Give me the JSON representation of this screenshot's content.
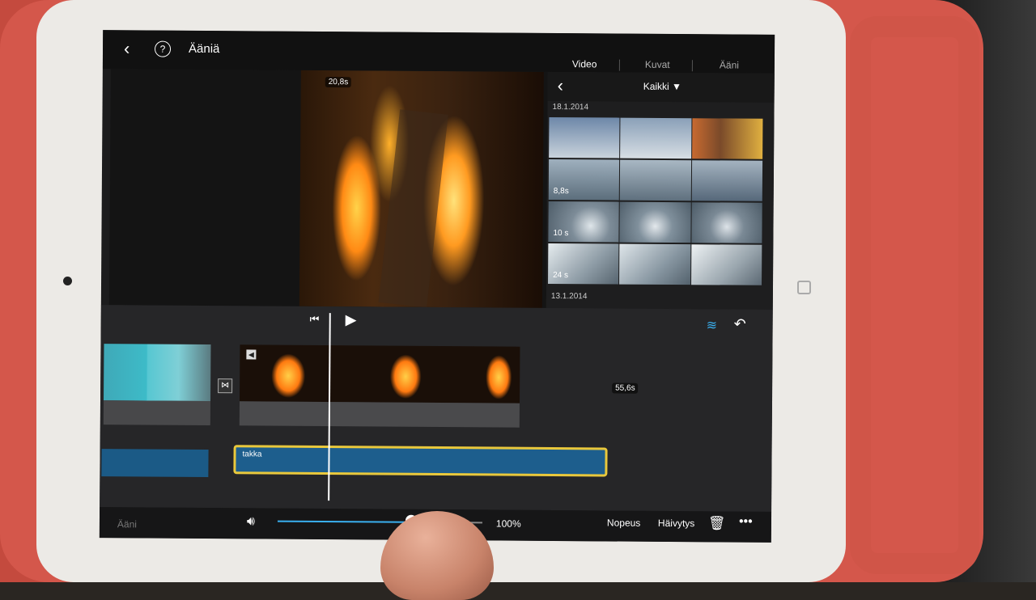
{
  "header": {
    "title": "Ääniä"
  },
  "preview": {
    "time_label": "20,8s"
  },
  "browser": {
    "tabs": [
      "Video",
      "Kuvat",
      "Ääni"
    ],
    "active_tab": "Video",
    "filter_label": "Kaikki ▼",
    "groups": [
      {
        "date": "18.1.2014",
        "rows": [
          {
            "duration": ""
          },
          {
            "duration": "8,8s"
          },
          {
            "duration": "10 s"
          },
          {
            "duration": "24 s"
          }
        ]
      },
      {
        "date": "13.1.2014",
        "rows": []
      }
    ]
  },
  "timeline": {
    "clip_length": "55,6s",
    "audio_clip_label": "takka"
  },
  "toolbar": {
    "section_label": "Ääni",
    "volume_percent": "100%",
    "volume_level": 0.65,
    "speed_label": "Nopeus",
    "fade_label": "Häivytys"
  },
  "colors": {
    "accent": "#3ab0f0",
    "selection": "#e9c83c",
    "audio": "#1d5e8d"
  }
}
